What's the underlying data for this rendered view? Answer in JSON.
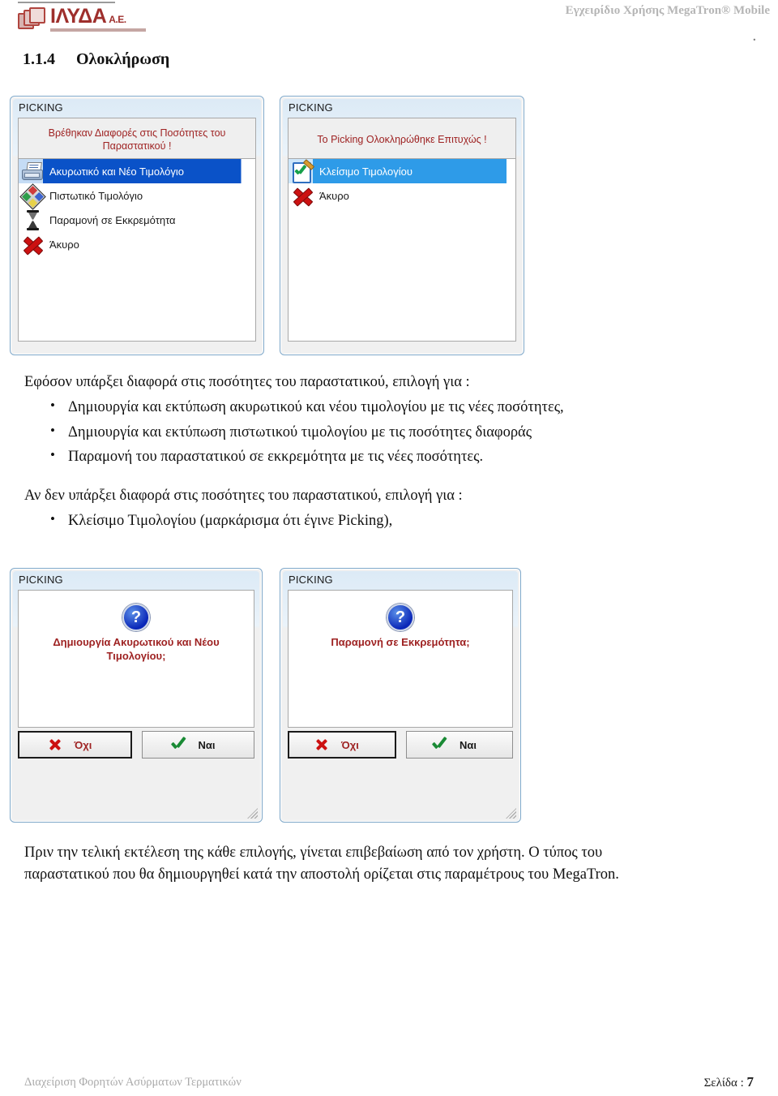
{
  "header": {
    "logo_word": "ΙΛΥΔΑ",
    "logo_suffix": "Α.Ε.",
    "manual_title": "Εγχειρίδιο Χρήσης MegaTron® Mobile",
    "corner_mark": "."
  },
  "section": {
    "number": "1.1.4",
    "title": "Ολοκλήρωση"
  },
  "dialogs": {
    "diff_found": {
      "window_title": "PICKING",
      "message": "Βρέθηκαν Διαφορές στις Ποσότητες του Παραστατικού !",
      "items": [
        {
          "label": "Ακυρωτικό και Νέο Τιμολόγιο",
          "icon": "printer-icon",
          "selected": true
        },
        {
          "label": "Πιστωτικό Τιμολόγιο",
          "icon": "credit-note-icon",
          "selected": false
        },
        {
          "label": "Παραμονή σε Εκκρεμότητα",
          "icon": "hourglass-icon",
          "selected": false
        },
        {
          "label": "Άκυρο",
          "icon": "red-x-icon",
          "selected": false
        }
      ]
    },
    "success": {
      "window_title": "PICKING",
      "message": "Το Picking Ολοκληρώθηκε Επιτυχώς !",
      "items": [
        {
          "label": "Κλείσιμο Τιμολογίου",
          "icon": "check-document-icon",
          "selected": true
        },
        {
          "label": "Άκυρο",
          "icon": "red-x-icon",
          "selected": false
        }
      ]
    },
    "confirm_new_invoice": {
      "window_title": "PICKING",
      "question": "Δημιουργία  Ακυρωτικού και Νέου Τιμολογίου;",
      "no_label": "Όχι",
      "yes_label": "Ναι",
      "question_mark": "?"
    },
    "confirm_pending": {
      "window_title": "PICKING",
      "question": "Παραμονή σε Εκκρεμότητα;",
      "no_label": "Όχι",
      "yes_label": "Ναι",
      "question_mark": "?"
    }
  },
  "body": {
    "intro_diff": "Εφόσον υπάρξει διαφορά στις ποσότητες του παραστατικού, επιλογή για :",
    "diff_bullets": [
      "Δημιουργία και εκτύπωση ακυρωτικού και νέου τιμολογίου με τις νέες ποσότητες,",
      "Δημιουργία και εκτύπωση πιστωτικού τιμολογίου με τις ποσότητες διαφοράς",
      "Παραμονή του παραστατικού σε εκκρεμότητα με τις νέες ποσότητες."
    ],
    "intro_nodiff": "Αν δεν υπάρξει διαφορά στις ποσότητες του παραστατικού, επιλογή για :",
    "nodiff_bullets": [
      "Κλείσιμο Τιμολογίου (μαρκάρισμα ότι έγινε Picking),"
    ],
    "closing_line1": "Πριν την τελική εκτέλεση της κάθε επιλογής, γίνεται επιβεβαίωση από τον χρήστη. Ο τύπος του",
    "closing_line2": "παραστατικού που θα δημιουργηθεί κατά την αποστολή ορίζεται στις παραμέτρους του MegaTron."
  },
  "footer": {
    "left": "Διαχείριση Φορητών Ασύρματων Τερματικών",
    "page_label": "Σελίδα : ",
    "page_number": "7"
  },
  "colors": {
    "brand_red": "#9e2f2c",
    "dialog_message_red": "#9e2222",
    "selection_blue_dark": "#0a52c8",
    "selection_blue_light": "#2e9be8",
    "header_gray": "#b6b6b6"
  }
}
